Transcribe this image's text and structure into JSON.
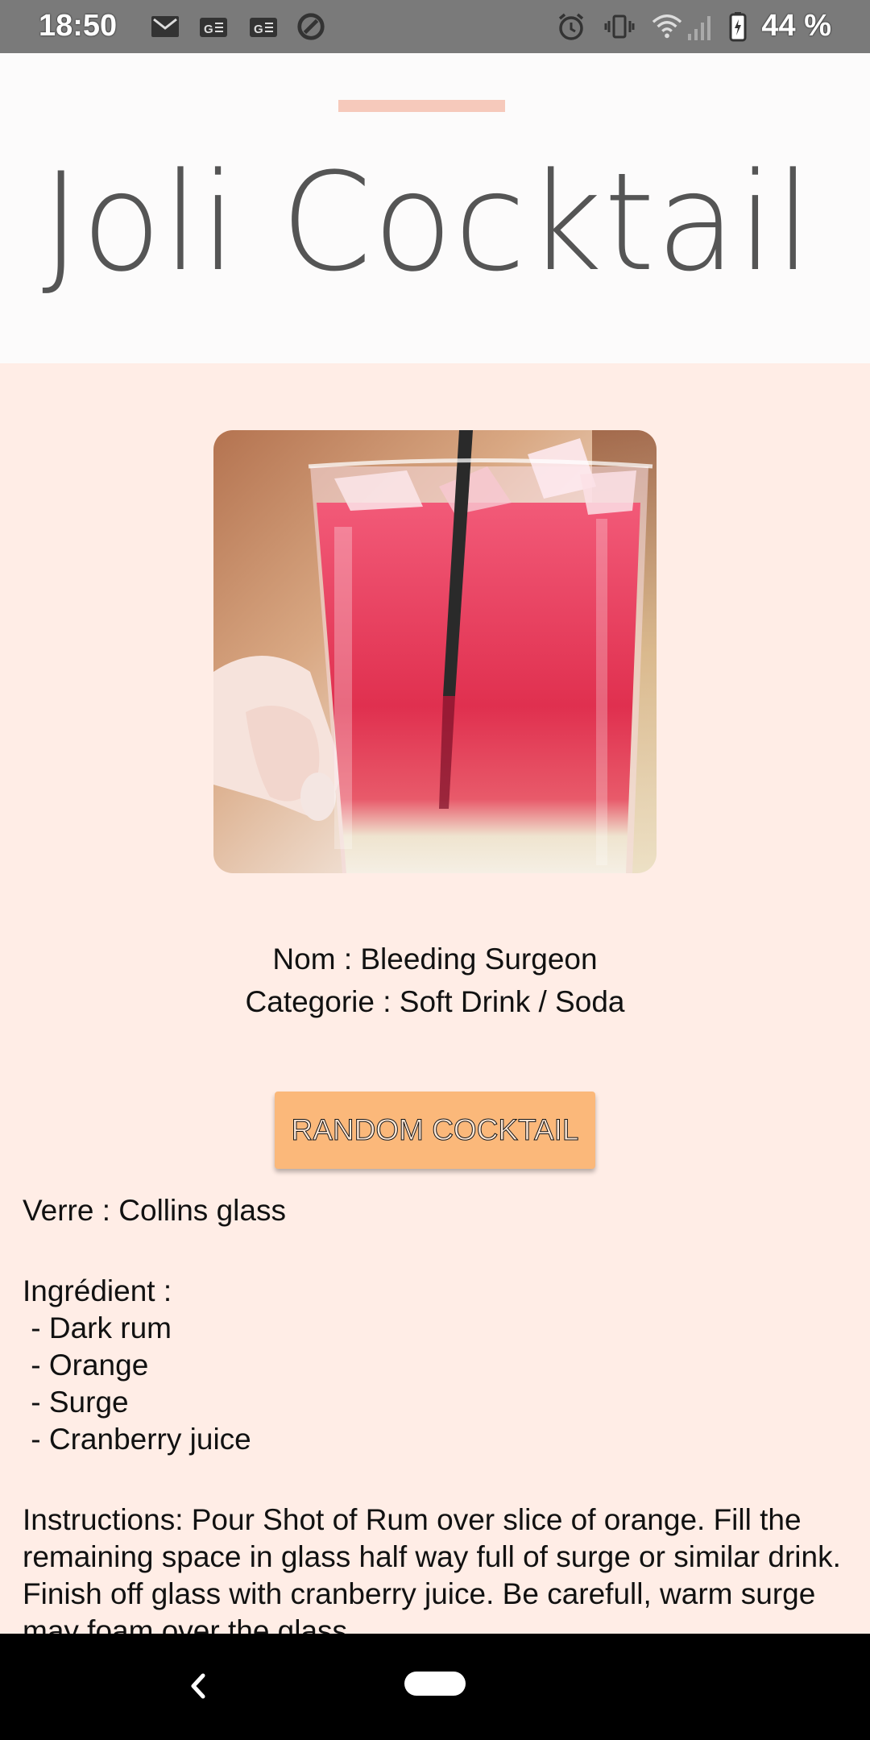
{
  "status_bar": {
    "time": "18:50",
    "battery_percent": "44 %",
    "icons_left": [
      "gmail-icon",
      "google-translate-icon",
      "google-translate-icon",
      "sync-icon"
    ],
    "icons_right": [
      "alarm-icon",
      "vibrate-icon",
      "wifi-icon",
      "signal-icon",
      "battery-icon"
    ]
  },
  "header": {
    "logo_text": "Joli Cocktail",
    "accent_color": "#f6c9bb"
  },
  "cocktail": {
    "image_alt": "cocktail-photo",
    "name_line": "Nom : Bleeding Surgeon",
    "category_line": "Categorie : Soft Drink / Soda",
    "glass_line": "Verre : Collins glass",
    "ingredients_title": "Ingrédient :",
    "ingredients": [
      " - Dark rum",
      " - Orange",
      " - Surge",
      " - Cranberry juice"
    ],
    "instructions": "Instructions: Pour Shot of Rum over slice of orange. Fill the remaining space in glass half way full of surge or similar drink. Finish off glass with cranberry juice. Be carefull, warm surge may foam over the glass."
  },
  "actions": {
    "random_label": "RANDOM COCKTAIL",
    "button_color": "#fbb87a"
  },
  "colors": {
    "background": "#ffede6",
    "header_bg": "#fcfbfb",
    "status_bg": "#7a7a7a"
  }
}
